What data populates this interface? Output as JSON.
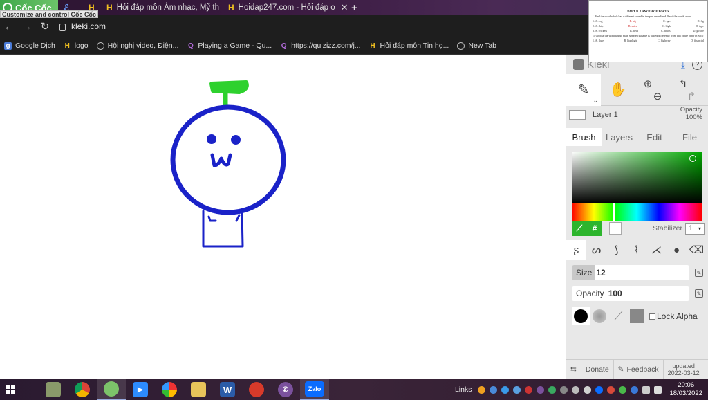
{
  "browser": {
    "brand": "Cốc Cốc",
    "tooltip": "Customize and control Cốc Cốc",
    "tabs": [
      {
        "label": "Hỏi đáp môn Âm nhạc, Mỹ th",
        "icon": "H"
      },
      {
        "label": "Hoidap247.com - Hỏi đáp o",
        "icon": "H"
      }
    ],
    "new_tab_symbol": "+",
    "close_symbol": "✕",
    "url": "kleki.com",
    "bookmarks": [
      {
        "label": "Google Dịch",
        "icon": "g"
      },
      {
        "label": "logo",
        "icon": "H"
      },
      {
        "label": "Hội nghị video, Điện...",
        "icon": "globe"
      },
      {
        "label": "Playing a Game - Qu...",
        "icon": "Q"
      },
      {
        "label": "https://quizizz.com/j...",
        "icon": "Q"
      },
      {
        "label": "Hỏi đáp môn Tin họ...",
        "icon": "H"
      },
      {
        "label": "New Tab",
        "icon": "globe"
      }
    ]
  },
  "doc_thumbnail": {
    "title": "PART B. LANGUAGE FOCUS",
    "line1": "I. Find the word which has a different sound in the part underlined. Read the words aloud",
    "row1": [
      "1. A. eng",
      "B. sig",
      "C. ago",
      "D. fig"
    ],
    "row2": [
      "2. A. ship",
      "B. spice",
      "C. high",
      "D. type"
    ],
    "row3": [
      "3. A. crickets",
      "B. field",
      "C. fields",
      "D. giraffe"
    ],
    "line2": "II. Choose the word whose main stressed syllable is placed differently from that of the other in each group.",
    "row4": [
      "1. A. flute",
      "B. highlight",
      "C. highway",
      "D. financial"
    ]
  },
  "drawing": {
    "stroke_color": "#1a22c8",
    "hat_color": "#2ed12e"
  },
  "kleki": {
    "app_name": "Kleki",
    "layer_name": "Layer 1",
    "opacity_label": "Opacity",
    "opacity_value": "100%",
    "tabs": [
      "Brush",
      "Layers",
      "Edit",
      "File"
    ],
    "color_hash": "#",
    "stabilizer_label": "Stabilizer",
    "stabilizer_value": "1",
    "size_label": "Size",
    "size_value": "12",
    "size_fraction": 0.2,
    "brush_opacity_label": "Opacity",
    "brush_opacity_value": "100",
    "lock_alpha": "Lock Alpha",
    "donate": "Donate",
    "feedback": "Feedback",
    "updated_label": "updated",
    "updated_date": "2022-03-12",
    "picker_hue_color": "#00aa00"
  },
  "taskbar": {
    "links_label": "Links",
    "time": "20:06",
    "date": "18/03/2022",
    "apps": [
      "explorer-photo",
      "chrome",
      "coccoc",
      "zoom",
      "picasa",
      "files",
      "word",
      "redapp",
      "viber",
      "zalo"
    ],
    "zalo_label": "Zalo",
    "word_label": "W"
  }
}
